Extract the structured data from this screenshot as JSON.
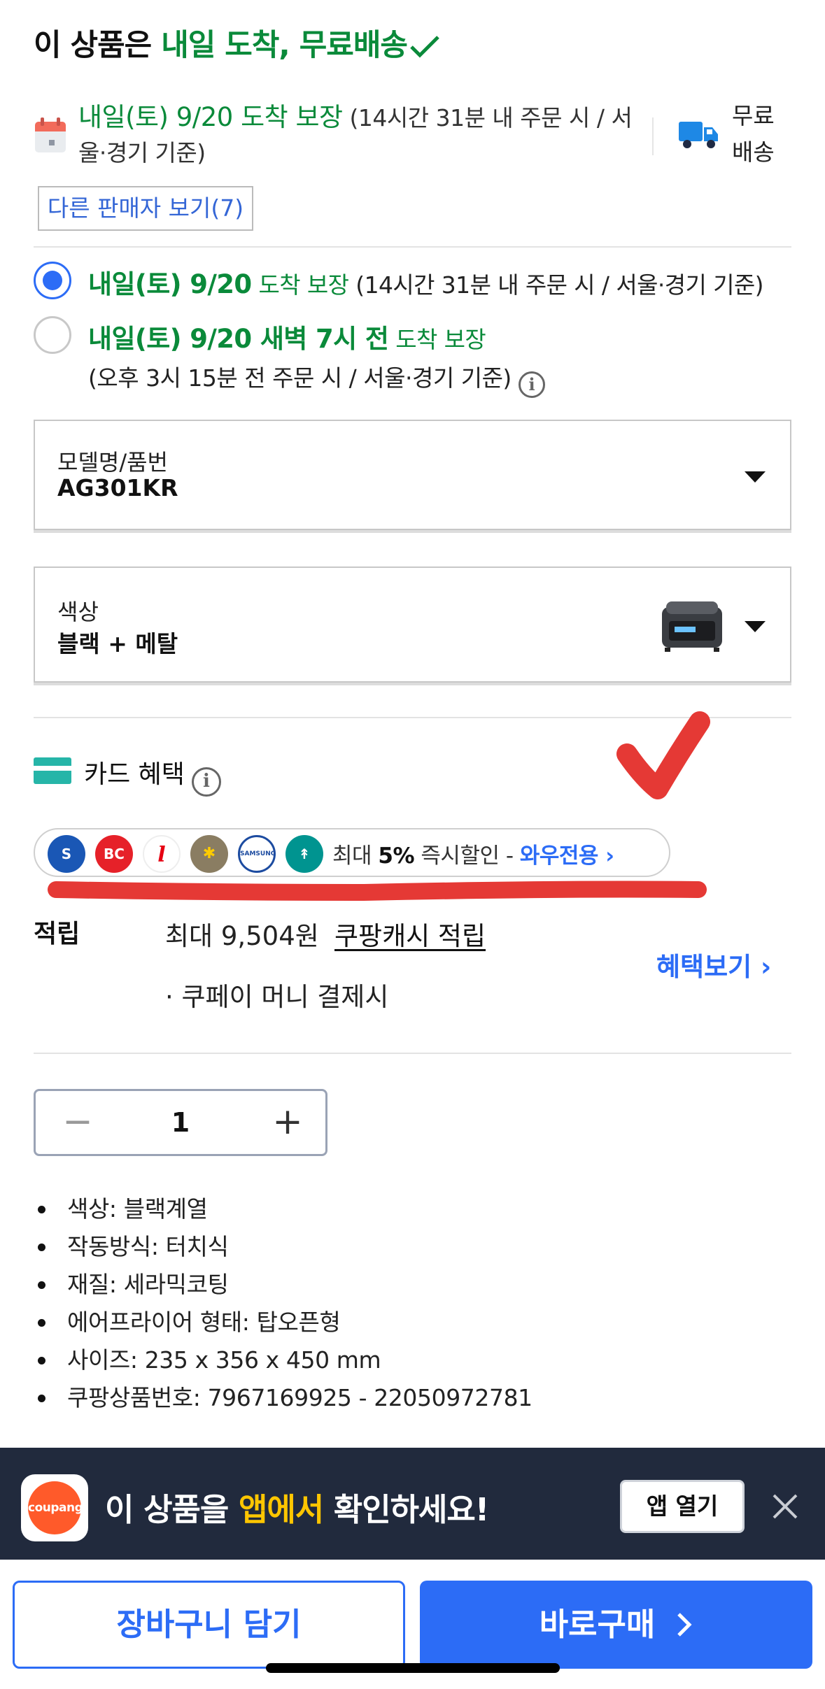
{
  "headline": {
    "prefix": "이 상품은 ",
    "highlight": "내일 도착, 무료배송"
  },
  "delivery": {
    "date": "내일(토) 9/20 도착 보장",
    "detail": " (14시간 31분 내 주문 시 / 서울·경기 기준)",
    "free_shipping": "무료 배송",
    "other_sellers": "다른 판매자 보기(7)"
  },
  "options": [
    {
      "selected": true,
      "date": "내일(토) 9/20",
      "guarantee": " 도착 보장",
      "detail": " (14시간 31분 내 주문 시 / 서울·경기 기준)"
    },
    {
      "selected": false,
      "date": "내일(토) 9/20 새벽 7시 전",
      "guarantee": " 도착 보장",
      "detail": "(오후 3시 15분 전 주문 시 / 서울·경기 기준)"
    }
  ],
  "model_select": {
    "label": "모델명/품번",
    "value": "AG301KR"
  },
  "color_select": {
    "label": "색상",
    "value": "블랙 + 메탈"
  },
  "card_benefit": {
    "title": "카드 혜택",
    "banks": [
      "shinhan",
      "bc",
      "lotte",
      "kb",
      "samsung",
      "hana"
    ],
    "text_prefix": "최대 ",
    "percent": "5%",
    "text_mid": " 즉시할인 - ",
    "wow": "와우전용"
  },
  "points": {
    "label": "적립",
    "amount": "최대 9,504원",
    "cash": "쿠팡캐시 적립",
    "note": "· 쿠페이 머니 결제시",
    "more": "혜택보기"
  },
  "quantity": {
    "value": "1",
    "minus": "−",
    "plus": "+"
  },
  "specs": [
    "색상: 블랙계열",
    "작동방식: 터치식",
    "재질: 세라믹코팅",
    "에어프라이어 형태: 탑오픈형",
    "사이즈: 235 x 356 x 450 mm",
    "쿠팡상품번호: 7967169925 - 22050972781"
  ],
  "app_banner": {
    "logo_text": "coupang",
    "text_prefix": "이 상품을 ",
    "text_highlight": "앱에서",
    "text_suffix": " 확인하세요!",
    "open_button": "앱 열기"
  },
  "actions": {
    "cart": "장바구니 담기",
    "buy": "바로구매"
  },
  "colors": {
    "green": "#0a8a3a",
    "blue": "#2c6cf6",
    "banner_bg": "#212a3d",
    "banner_highlight": "#ffc600",
    "annotation_red": "#e53935"
  }
}
